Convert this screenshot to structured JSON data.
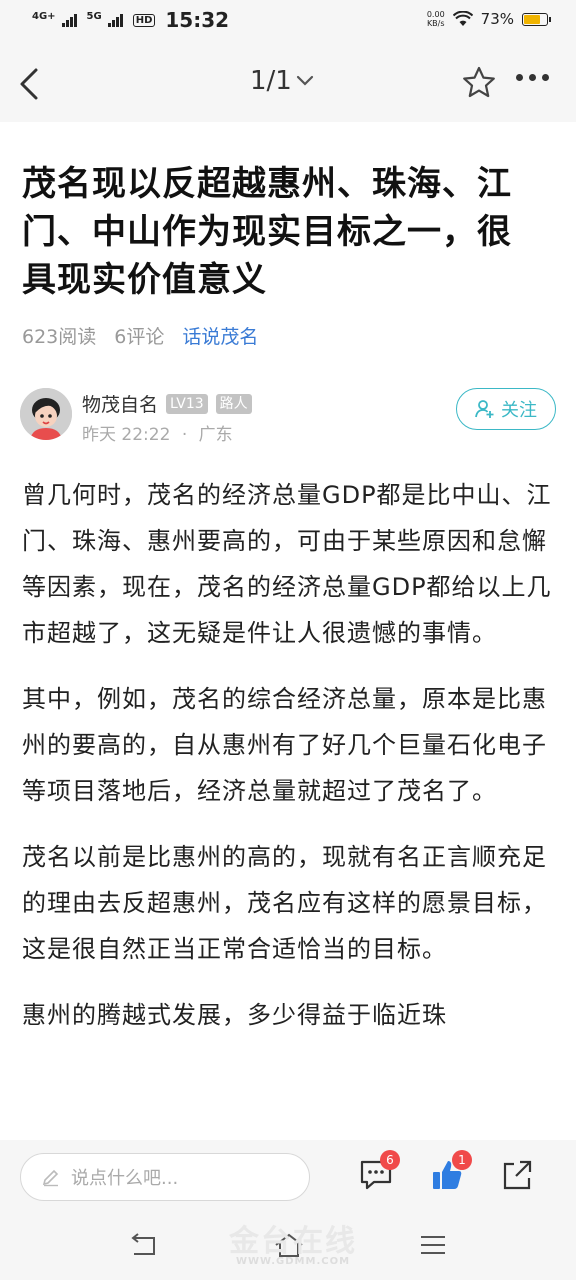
{
  "status_bar": {
    "network_1": "4G+",
    "network_2": "5G",
    "hd": "HD",
    "time": "15:32",
    "speed_value": "0.00",
    "speed_unit": "KB/s",
    "battery_percent": "73%",
    "battery_level": 0.73
  },
  "nav": {
    "page_indicator": "1/1"
  },
  "article": {
    "title": "茂名现以反超越惠州、珠海、江门、中山作为现实目标之一，很具现实价值意义",
    "reads": "623阅读",
    "comments": "6评论",
    "topic": "话说茂名",
    "author": {
      "name": "物茂自名",
      "level": "LV13",
      "rank": "路人",
      "time": "昨天 22:22",
      "location": "广东",
      "follow_label": "关注"
    },
    "paragraphs": [
      "曾几何时，茂名的经济总量GDP都是比中山、江门、珠海、惠州要高的，可由于某些原因和怠懈等因素，现在，茂名的经济总量GDP都给以上几市超越了，这无疑是件让人很遗憾的事情。",
      "其中，例如，茂名的综合经济总量，原本是比惠州的要高的，自从惠州有了好几个巨量石化电子等项目落地后，经济总量就超过了茂名了。",
      "茂名以前是比惠州的高的，现就有名正言顺充足的理由去反超惠州，茂名应有这样的愿景目标，这是很自然正当正常合适恰当的目标。",
      "惠州的腾越式发展，多少得益于临近珠"
    ]
  },
  "comment_bar": {
    "placeholder": "说点什么吧...",
    "comment_count": "6",
    "like_count": "1"
  },
  "watermark": {
    "text": "金台在线",
    "url": "WWW.GDMM.COM"
  },
  "colors": {
    "accent": "#3a7bd5",
    "follow": "#3bb8c6",
    "badge_red": "#f04a4a",
    "like_blue": "#2f7de1"
  }
}
